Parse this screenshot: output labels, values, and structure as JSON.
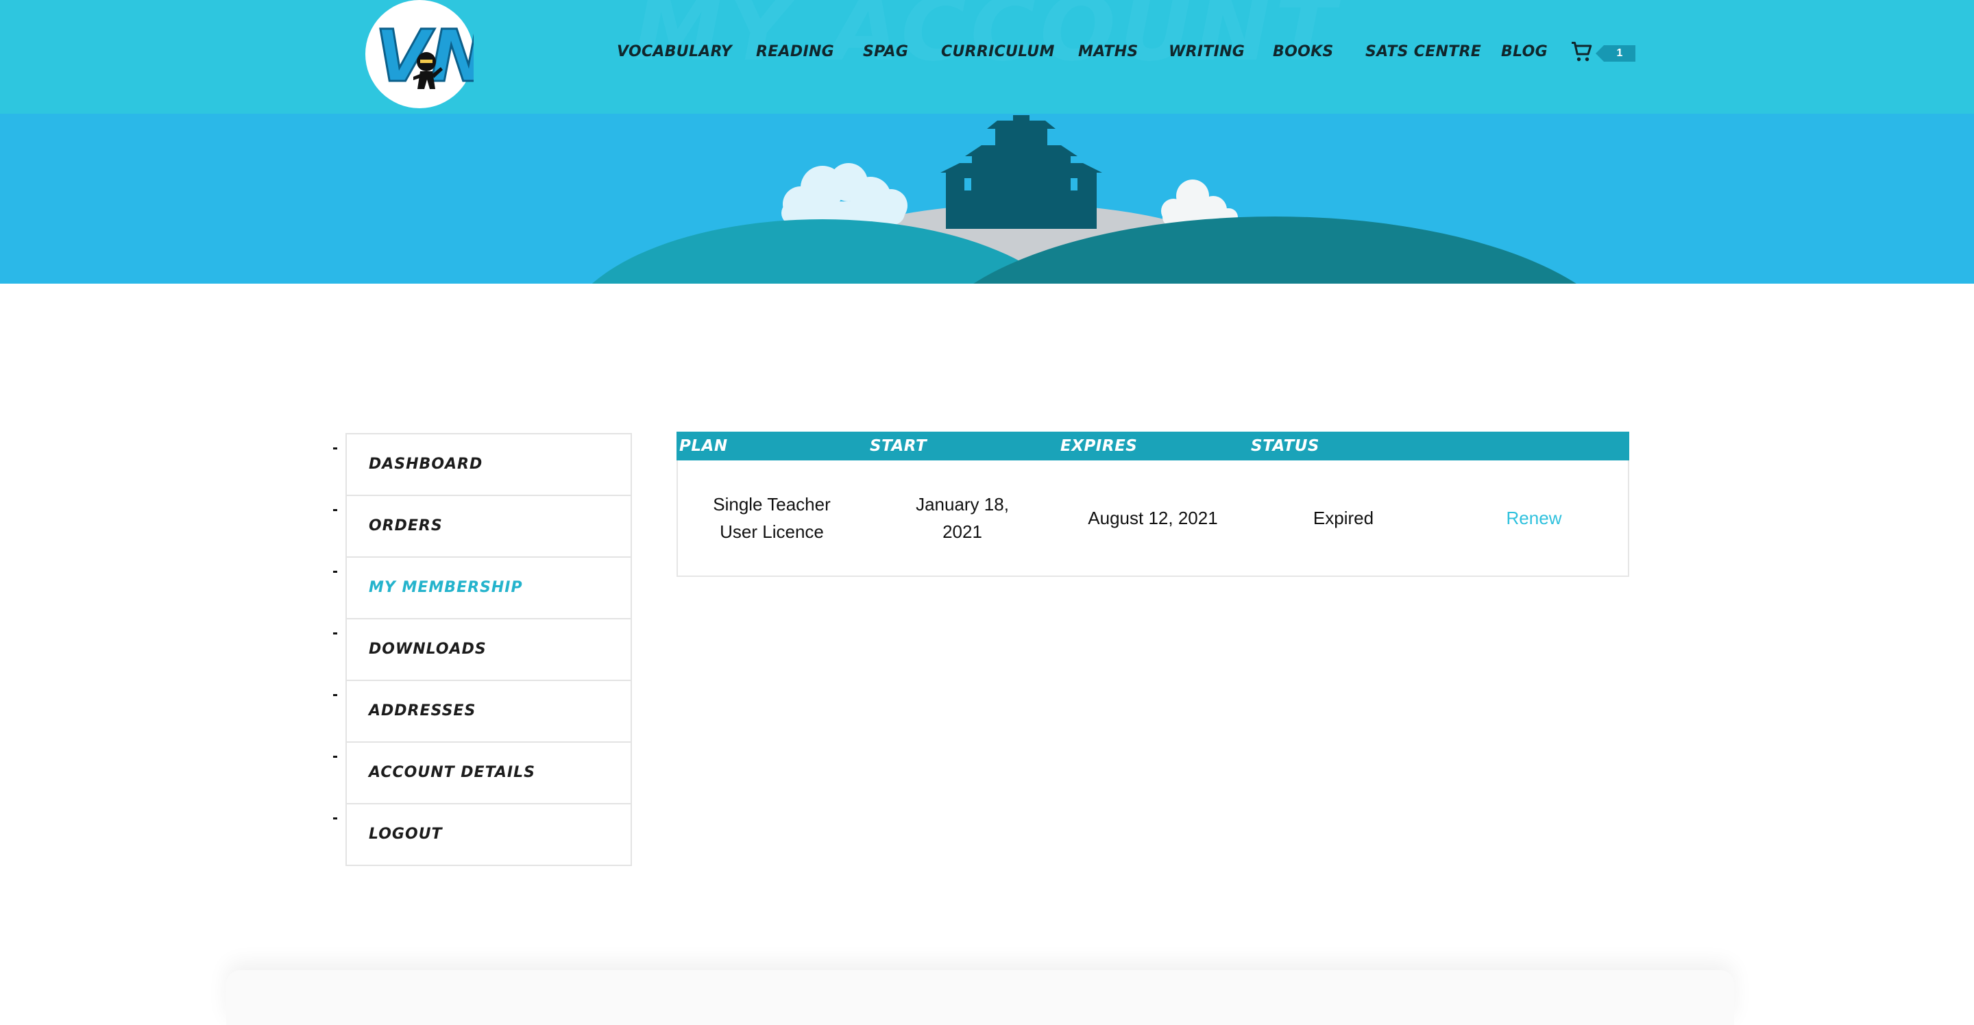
{
  "header": {
    "ghost_title": "MY ACCOUNT",
    "logo_text": "VN",
    "nav": [
      {
        "label": "VOCABULARY"
      },
      {
        "label": "READING"
      },
      {
        "label": "SPAG"
      },
      {
        "label": "CURRICULUM"
      },
      {
        "label": "MATHS"
      },
      {
        "label": "WRITING"
      },
      {
        "label": "BOOKS"
      },
      {
        "label": "SATS CENTRE"
      },
      {
        "label": "BLOG"
      }
    ],
    "cart_icon": "shopping-cart-icon",
    "cart_count": "1"
  },
  "sidebar": {
    "items": [
      {
        "label": "DASHBOARD"
      },
      {
        "label": "ORDERS"
      },
      {
        "label": "MY MEMBERSHIP"
      },
      {
        "label": "DOWNLOADS"
      },
      {
        "label": "ADDRESSES"
      },
      {
        "label": "ACCOUNT DETAILS"
      },
      {
        "label": "LOGOUT"
      }
    ],
    "active": "MY MEMBERSHIP"
  },
  "membership": {
    "columns": [
      "PLAN",
      "START",
      "EXPIRES",
      "STATUS",
      ""
    ],
    "rows": [
      {
        "plan": "Single Teacher User Licence",
        "start": "January 18, 2021",
        "expires": "August 12, 2021",
        "status": "Expired",
        "action": "Renew"
      }
    ]
  },
  "colors": {
    "header_bg": "#2ec6df",
    "hero_bg": "#2bb8e8",
    "table_header": "#1aa3b9",
    "accent_link": "#2fc1dd"
  }
}
